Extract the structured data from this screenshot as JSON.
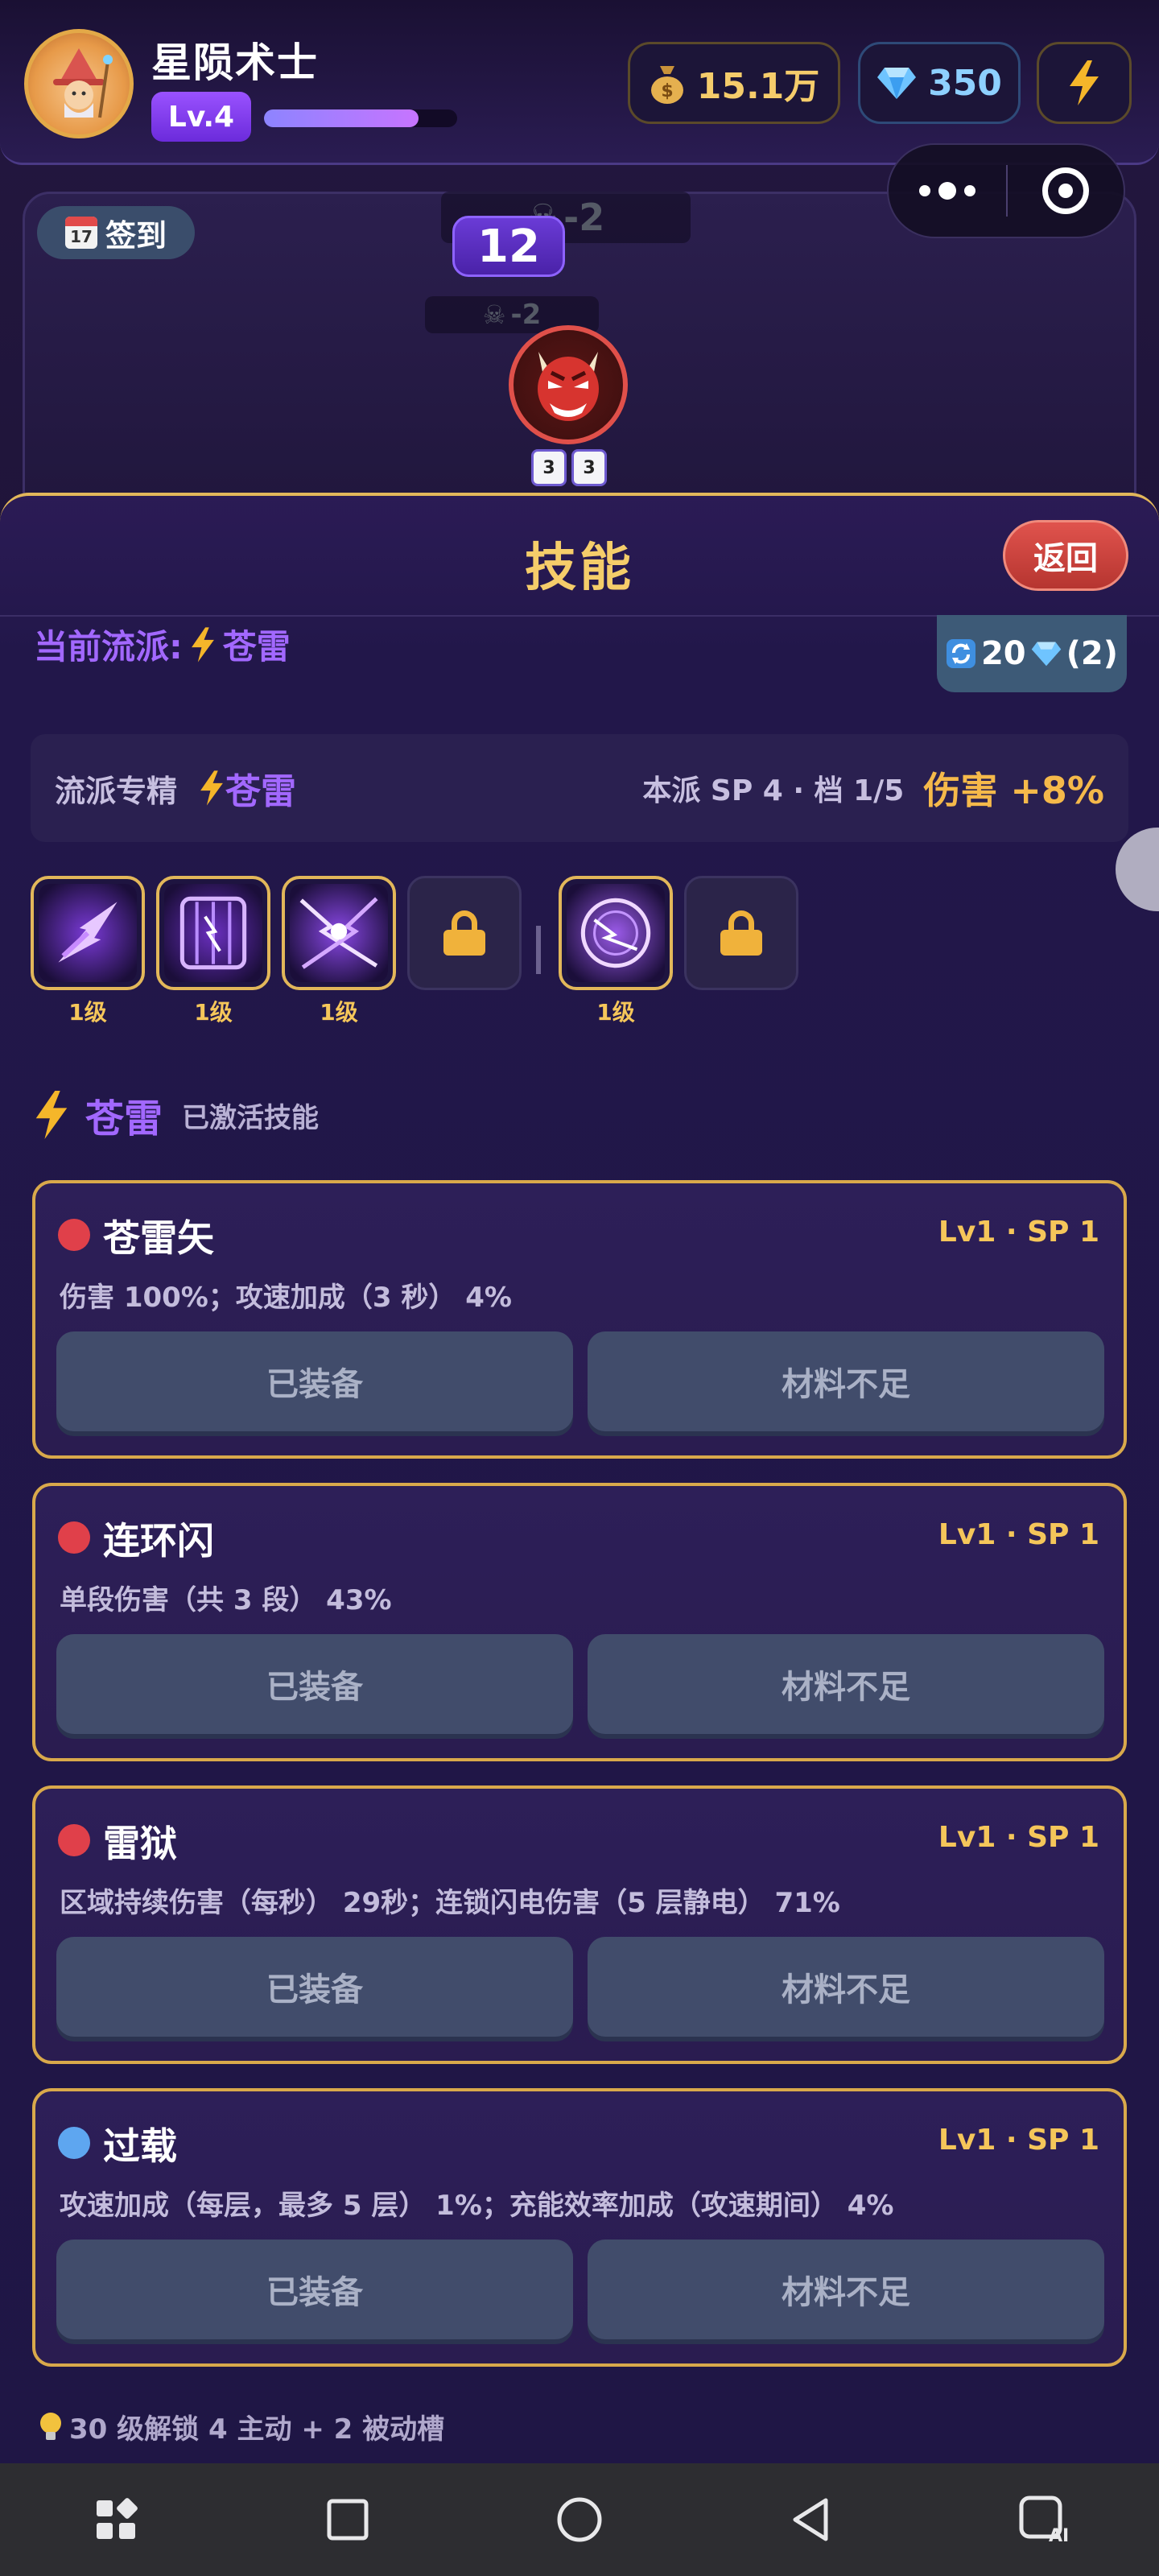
{
  "header": {
    "player_name": "星陨术士",
    "level": "Lv.4",
    "xp_fraction": 0.8,
    "coins": "15.1万",
    "gems": "350"
  },
  "battle": {
    "checkin_label": "签到",
    "calendar_label": "17",
    "wave": "12",
    "float_damage_1": "-2",
    "float_damage_2": "-2",
    "boss_buff_1": "3",
    "boss_buff_2": "3"
  },
  "panel": {
    "title": "技能",
    "back_label": "返回",
    "current_school_prefix": "当前流派:",
    "current_school": "苍雷",
    "reset_cost": "20",
    "reset_count": "(2)",
    "mastery_label": "流派专精",
    "mastery_school": "苍雷",
    "mastery_info": "本派 SP 4 · 档 1/5",
    "mastery_bonus": "伤害 +8%",
    "slots": [
      {
        "level": "1级",
        "art": "bolt-arrow"
      },
      {
        "level": "1级",
        "art": "lightning-cage"
      },
      {
        "level": "1级",
        "art": "chain-lightning"
      },
      {
        "level": "1级",
        "art": "thunder-orb"
      }
    ],
    "active_title": "苍雷",
    "active_subtitle": "已激活技能",
    "hint": "30 级解锁 4 主动 + 2 被动槽"
  },
  "skills": [
    {
      "name": "苍雷矢",
      "lvsp": "Lv1 · SP 1",
      "desc": "伤害 100%；攻速加成（3 秒） 4%",
      "equip_label": "已装备",
      "material_label": "材料不足",
      "dot_color": "#e0404a"
    },
    {
      "name": "连环闪",
      "lvsp": "Lv1 · SP 1",
      "desc": "单段伤害（共 3 段） 43%",
      "equip_label": "已装备",
      "material_label": "材料不足",
      "dot_color": "#e0404a"
    },
    {
      "name": "雷狱",
      "lvsp": "Lv1 · SP 1",
      "desc": "区域持续伤害（每秒） 29秒；连锁闪电伤害（5 层静电） 71%",
      "equip_label": "已装备",
      "material_label": "材料不足",
      "dot_color": "#e0404a"
    },
    {
      "name": "过载",
      "lvsp": "Lv1 · SP 1",
      "desc": "攻速加成（每层，最多 5 层） 1%；充能效率加成（攻速期间） 4%",
      "equip_label": "已装备",
      "material_label": "材料不足",
      "dot_color": "#5ea6f0"
    }
  ],
  "colors": {
    "accent_purple": "#a268ff",
    "gold": "#f5c65a",
    "panel_border": "#e2b75a"
  }
}
